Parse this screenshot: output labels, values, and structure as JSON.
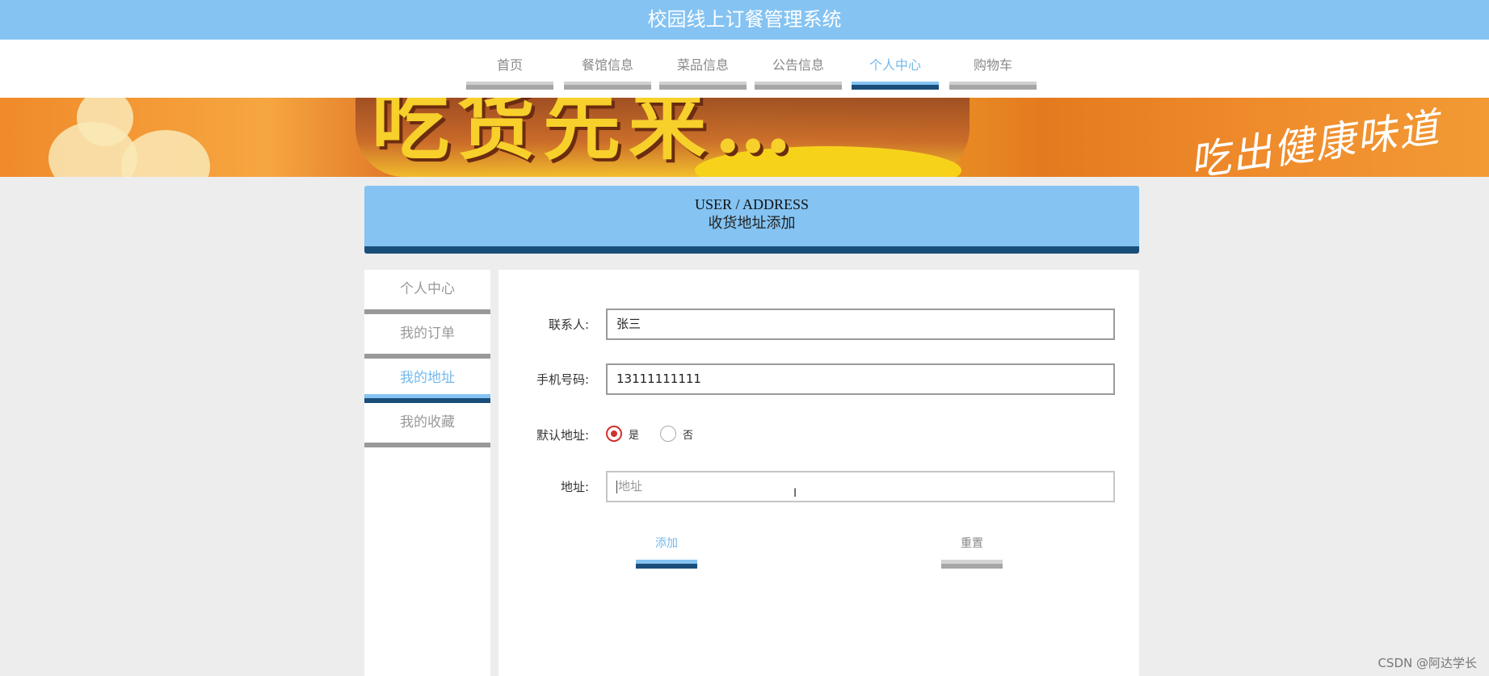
{
  "app": {
    "title": "校园线上订餐管理系统"
  },
  "nav": {
    "items": [
      {
        "label": "首页"
      },
      {
        "label": "餐馆信息"
      },
      {
        "label": "菜品信息"
      },
      {
        "label": "公告信息"
      },
      {
        "label": "个人中心",
        "active": true
      },
      {
        "label": "购物车"
      }
    ]
  },
  "banner": {
    "slogan": "吃出健康味道",
    "headline": "吃货先来…"
  },
  "page_header": {
    "en": "USER / ADDRESS",
    "cn": "收货地址添加"
  },
  "sidebar": {
    "items": [
      {
        "label": "个人中心"
      },
      {
        "label": "我的订单"
      },
      {
        "label": "我的地址",
        "active": true
      },
      {
        "label": "我的收藏"
      }
    ]
  },
  "form": {
    "contact": {
      "label": "联系人:",
      "value": "张三"
    },
    "phone": {
      "label": "手机号码:",
      "value": "13111111111"
    },
    "default_address": {
      "label": "默认地址:",
      "options": [
        {
          "label": "是",
          "selected": true
        },
        {
          "label": "否",
          "selected": false
        }
      ]
    },
    "address": {
      "label": "地址:",
      "value": "",
      "placeholder": "地址"
    },
    "submit_label": "添加",
    "reset_label": "重置"
  },
  "watermark": "CSDN @阿达学长",
  "colors": {
    "primary": "#84c3f2",
    "dark": "#1a4e7a",
    "inactive_bar": "#a6a6a6",
    "radio": "#d0302e"
  }
}
